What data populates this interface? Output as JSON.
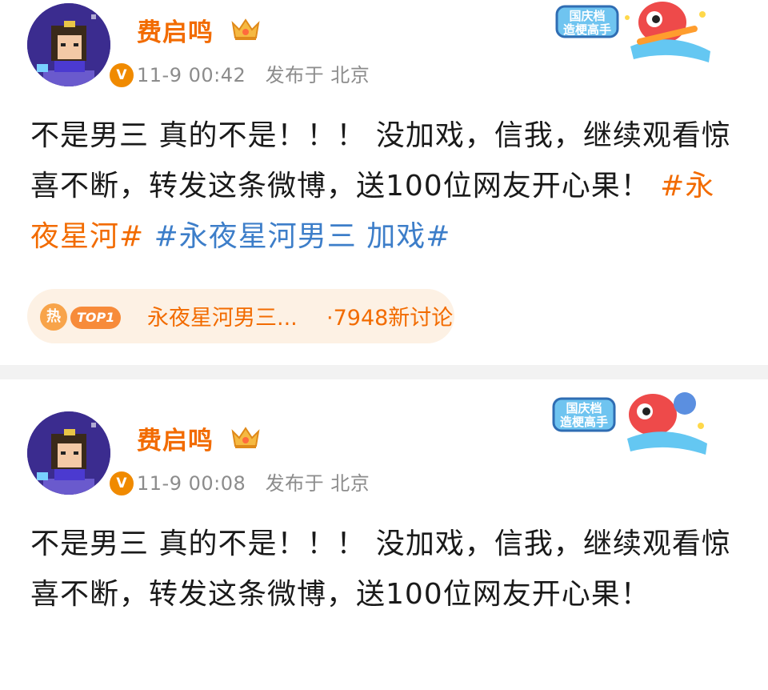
{
  "posts": [
    {
      "author": "费启鸣",
      "time": "11-9 00:42",
      "location": "发布于 北京",
      "verified_badge": "V",
      "sticker_text": [
        "国庆档",
        "造梗高手"
      ],
      "content_text": "不是男三 真的不是！！！ 没加戏，信我，继续观看惊喜不断，转发这条微博，送100位网友开心果！ ",
      "topics": [
        "#永夜星河#",
        "#永夜星河男三 加戏#"
      ],
      "hot_topic": {
        "icon_label": "热",
        "rank_label": "TOP1",
        "title": "永夜星河男三...",
        "count": "·7948新讨论"
      }
    },
    {
      "author": "费启鸣",
      "time": "11-9 00:08",
      "location": "发布于 北京",
      "verified_badge": "V",
      "sticker_text": [
        "国庆档",
        "造梗高手"
      ],
      "content_text": "不是男三 真的不是！！！ 没加戏，信我，继续观看惊喜不断，转发这条微博，送100位网友开心果！"
    }
  ],
  "colors": {
    "author_name": "#f26b00",
    "topic_orange": "#f26b00",
    "topic_blue": "#3d7ec9",
    "meta_gray": "#8c8c8c",
    "divider": "#f2f2f2",
    "hot_pill_bg": "#fdf1e4"
  },
  "icons": [
    "crown-icon",
    "verified-icon",
    "hot-icon",
    "mascot-sticker"
  ]
}
